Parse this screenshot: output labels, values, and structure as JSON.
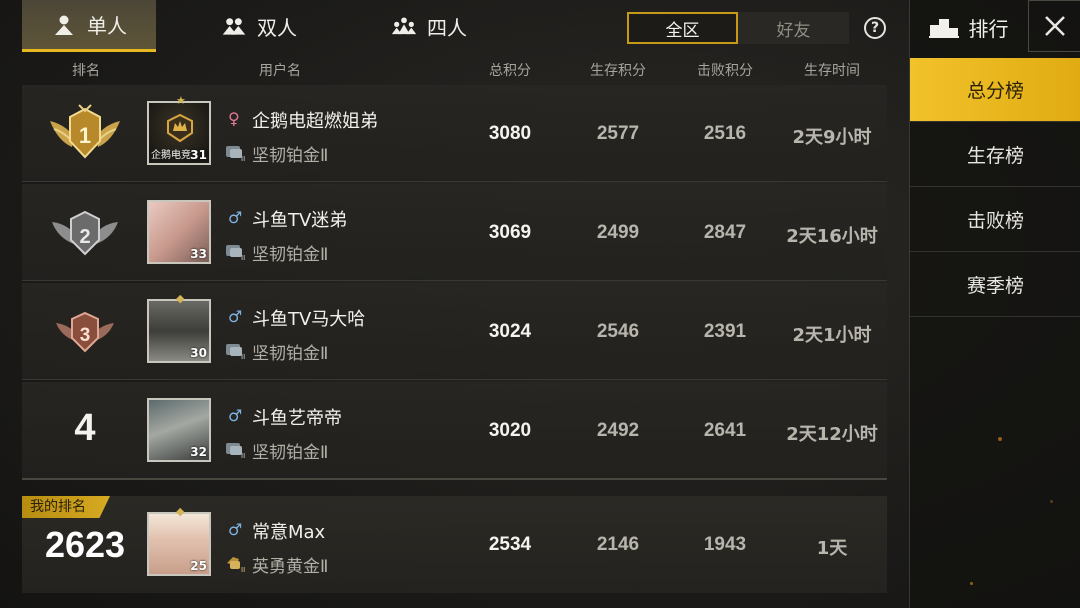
{
  "modes": [
    {
      "label": "单人",
      "icon": "single-player-icon",
      "active": true
    },
    {
      "label": "双人",
      "icon": "duo-icon",
      "active": false
    },
    {
      "label": "四人",
      "icon": "squad-icon",
      "active": false
    }
  ],
  "region": {
    "all": "全区",
    "friends": "好友",
    "active": "all"
  },
  "columns": {
    "rank": "排名",
    "username": "用户名",
    "total": "总积分",
    "survival": "生存积分",
    "kill": "击败积分",
    "time": "生存时间"
  },
  "rows": [
    {
      "rank": "1",
      "gender": "♀",
      "gender_type": "female",
      "name": "企鹅电超燃姐弟",
      "tier": "坚韧铂金Ⅱ",
      "level": "31",
      "avatar_text": "企鹅电竞",
      "total": "3080",
      "survival": "2577",
      "kill": "2516",
      "time": "2天9小时"
    },
    {
      "rank": "2",
      "gender": "♂",
      "gender_type": "male",
      "name": "斗鱼TV迷弟",
      "tier": "坚韧铂金Ⅱ",
      "level": "33",
      "total": "3069",
      "survival": "2499",
      "kill": "2847",
      "time": "2天16小时"
    },
    {
      "rank": "3",
      "gender": "♂",
      "gender_type": "male",
      "name": "斗鱼TV马大哈",
      "tier": "坚韧铂金Ⅱ",
      "level": "30",
      "total": "3024",
      "survival": "2546",
      "kill": "2391",
      "time": "2天1小时"
    },
    {
      "rank": "4",
      "gender": "♂",
      "gender_type": "male",
      "name": "斗鱼艺帝帝",
      "tier": "坚韧铂金Ⅱ",
      "level": "32",
      "total": "3020",
      "survival": "2492",
      "kill": "2641",
      "time": "2天12小时"
    }
  ],
  "my_rank": {
    "label": "我的排名",
    "rank": "2623",
    "gender": "♂",
    "name": "常意Max",
    "tier": "英勇黄金Ⅱ",
    "level": "25",
    "total": "2534",
    "survival": "2146",
    "kill": "1943",
    "time": "1天"
  },
  "right_panel": {
    "title": "排行",
    "items": [
      "总分榜",
      "生存榜",
      "击败榜",
      "赛季榜"
    ],
    "active_index": 0
  },
  "colors": {
    "accent": "#e8b820",
    "background": "#1c1b19"
  }
}
